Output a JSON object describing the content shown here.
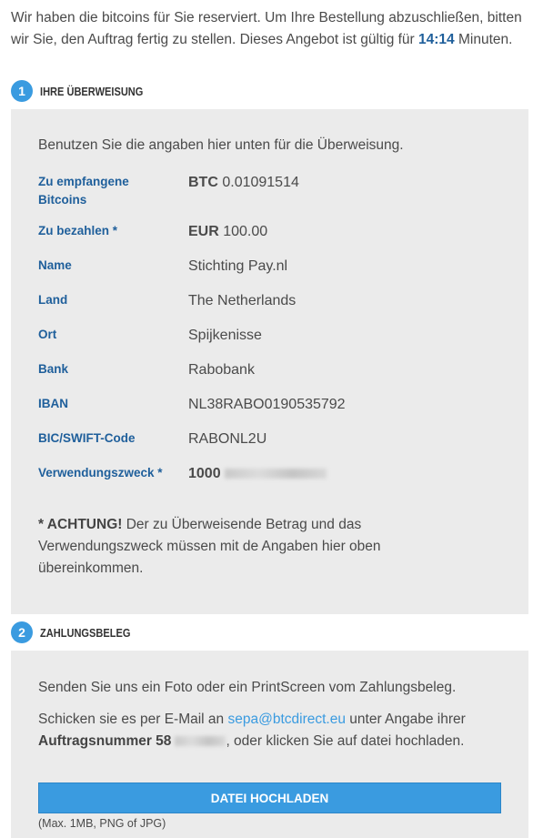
{
  "intro": {
    "text_before": "Wir haben die bitcoins für Sie reserviert. Um Ihre Bestellung abzuschließen, bitten wir Sie, den Auftrag fertig zu stellen. Dieses Angebot ist gültig für ",
    "timer": "14:14",
    "text_after": " Minuten."
  },
  "step1": {
    "number": "1",
    "title": "IHRE ÜBERWEISUNG",
    "instruction": "Benutzen Sie die angaben hier unten für die Überweisung.",
    "rows": [
      {
        "label": "Zu empfangene Bitcoins",
        "prefix": "BTC",
        "value": "0.01091514"
      },
      {
        "label": "Zu bezahlen *",
        "prefix": "EUR",
        "value": "100.00"
      },
      {
        "label": "Name",
        "prefix": "",
        "value": "Stichting Pay.nl"
      },
      {
        "label": "Land",
        "prefix": "",
        "value": "The Netherlands"
      },
      {
        "label": "Ort",
        "prefix": "",
        "value": "Spijkenisse"
      },
      {
        "label": "Bank",
        "prefix": "",
        "value": "Rabobank"
      },
      {
        "label": "IBAN",
        "prefix": "",
        "value": "NL38RABO0190535792"
      },
      {
        "label": "BIC/SWIFT-Code",
        "prefix": "",
        "value": "RABONL2U"
      },
      {
        "label": "Verwendungszweck *",
        "prefix": "1000",
        "value": ""
      }
    ],
    "warning_bold": "* ACHTUNG!",
    "warning_text": " Der zu Überweisende Betrag und das Verwendungszweck müssen mit de Angaben hier oben übereinkommen."
  },
  "step2": {
    "number": "2",
    "title": "ZAHLUNGSBELEG",
    "line1": "Senden Sie uns ein Foto oder ein PrintScreen vom Zahlungsbeleg.",
    "line2_a": "Schicken sie es per E-Mail an ",
    "email": "sepa@btcdirect.eu",
    "line2_b": " unter Angabe ihrer ",
    "order_label": "Auftragsnummer 58",
    "line2_c": ", oder klicken Sie auf datei hochladen.",
    "button": "DATEI HOCHLADEN",
    "note": "(Max. 1MB, PNG of JPG)"
  },
  "colors": {
    "accent": "#3a9be0",
    "label_blue": "#1f5f9b",
    "panel_bg": "#ebebeb"
  }
}
